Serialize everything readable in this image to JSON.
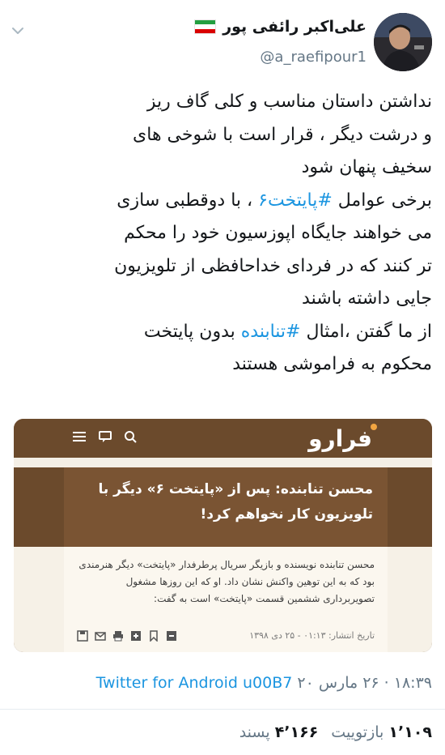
{
  "tweet": {
    "author": {
      "display_name": "علی‌اکبر رائفی پور",
      "handle": "@a_raefipour1",
      "flag": "iran-flag-icon"
    },
    "text_lines": [
      "نداشتن داستان مناسب و کلی گاف ریز",
      "و درشت دیگر ، قرار است با شوخی های",
      "سخیف پنهان شود",
      "برخی عوامل ",
      "می خواهند جایگاه اپوزسیون خود را محکم",
      "تر کنند که در فردای خداحافظی از تلویزیون",
      "جایی داشته باشند",
      "از ما گفتن ،امثال ",
      "محکوم به فراموشی هستند"
    ],
    "hashtag_1": "#پایتخت۶",
    "after_hashtag_1": " ، با دوقطبی سازی",
    "hashtag_2": "#تنابنده",
    "after_hashtag_2": " بدون پایتخت",
    "timestamp": "۱۸:۳۹ · ۲۶ مارس ۲۰",
    "source": "Twitter for Android",
    "source_suffix": "u00B7",
    "retweets_count": "۱٬۱۰۹",
    "retweets_label": "بازتوییت",
    "likes_count": "۴٬۱۶۶",
    "likes_label": "پسند"
  },
  "card": {
    "logo": "فرارو",
    "headline": "محسن تنابنده: پس از «پایتخت ۶» دیگر با تلویزیون کار نخواهم کرد!",
    "summary": "محسن تنابنده نویسنده و بازیگر سریال پرطرفدار «پایتخت» دیگر هنرمندی بود که به این توهین واکنش نشان داد. او که این روزها مشغول تصویربرداری ششمین قسمت «پایتخت» است به گفت:",
    "date": "تاریخ انتشار: ۰۱:۱۳ - ۲۵ دی ۱۳۹۸",
    "header_color": "#6b4a2c",
    "accent_color": "#f2a541"
  },
  "colors": {
    "link": "#1b95e0",
    "secondary": "#657786",
    "text": "#14171a"
  },
  "icons": {
    "menu": "chevron-down-icon",
    "card_menu": "hamburger-icon",
    "card_chat": "chat-icon",
    "card_search": "search-icon"
  }
}
